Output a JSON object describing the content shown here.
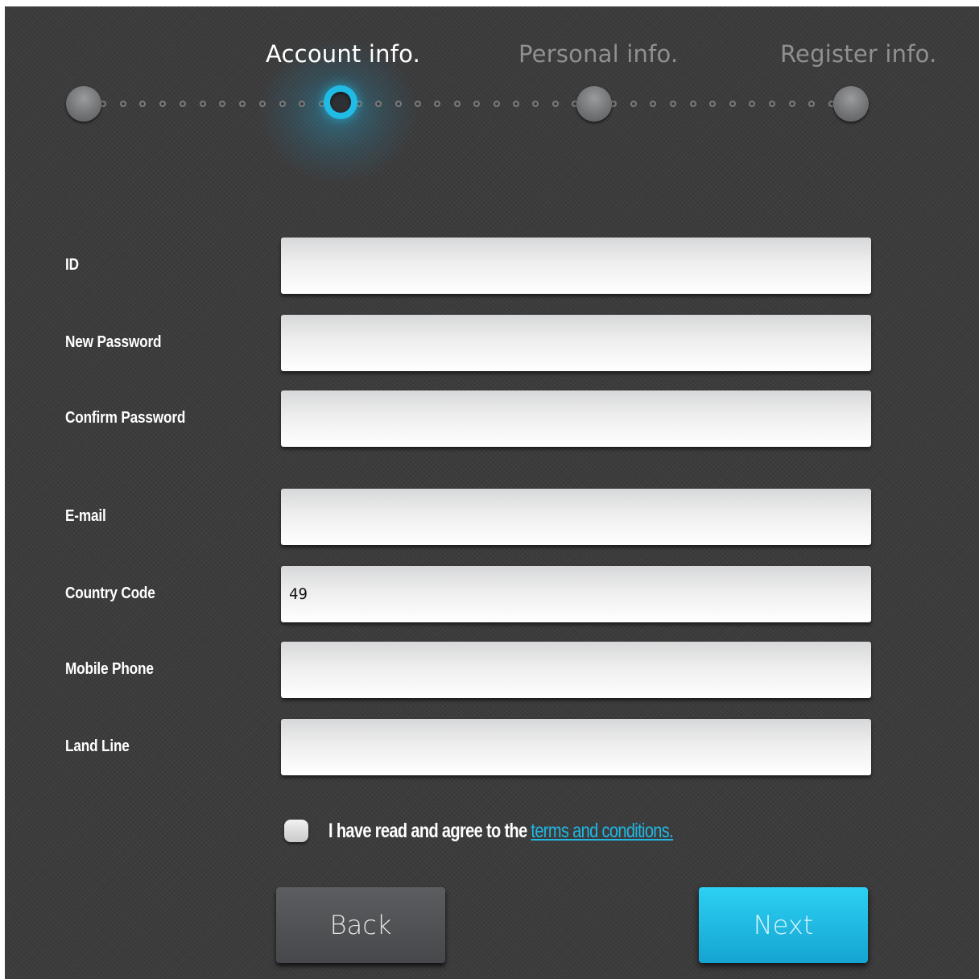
{
  "wizard": {
    "steps": [
      {
        "label": "Account info.",
        "state": "active"
      },
      {
        "label": "Personal info.",
        "state": "inactive"
      },
      {
        "label": "Register info.",
        "state": "inactive"
      }
    ],
    "accent_color": "#20bce6"
  },
  "form": {
    "fields": [
      {
        "label": "ID",
        "value": ""
      },
      {
        "label": "New Password",
        "value": ""
      },
      {
        "label": "Confirm Password",
        "value": ""
      },
      {
        "label": "E-mail",
        "value": ""
      },
      {
        "label": "Country Code",
        "value": "49"
      },
      {
        "label": "Mobile Phone",
        "value": ""
      },
      {
        "label": "Land Line",
        "value": ""
      }
    ]
  },
  "agreement": {
    "checked": false,
    "text": "I have read and agree to the",
    "link_text": "terms and conditions."
  },
  "buttons": {
    "back_label": "Back",
    "next_label": "Next"
  }
}
